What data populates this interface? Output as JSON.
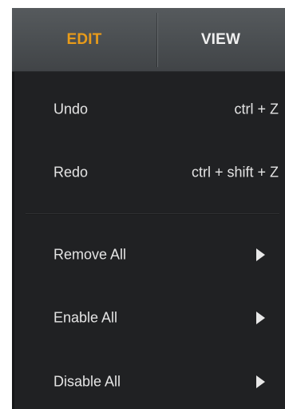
{
  "menubar": {
    "tabs": [
      {
        "label": "EDIT",
        "active": true,
        "color": "#e89b1a"
      },
      {
        "label": "VIEW",
        "active": false,
        "color": "#f0f0f0"
      }
    ]
  },
  "dropdown": {
    "items": [
      {
        "label": "Undo",
        "shortcut": "ctrl + Z"
      },
      {
        "label": "Redo",
        "shortcut": "ctrl + shift + Z"
      },
      {
        "label": "Remove All",
        "submenu_icon": "submenu-arrow-icon"
      },
      {
        "label": "Enable All",
        "submenu_icon": "submenu-arrow-icon"
      },
      {
        "label": "Disable All",
        "submenu_icon": "submenu-arrow-icon"
      }
    ],
    "background_color": "#202123",
    "text_color": "#e4e4e4"
  }
}
